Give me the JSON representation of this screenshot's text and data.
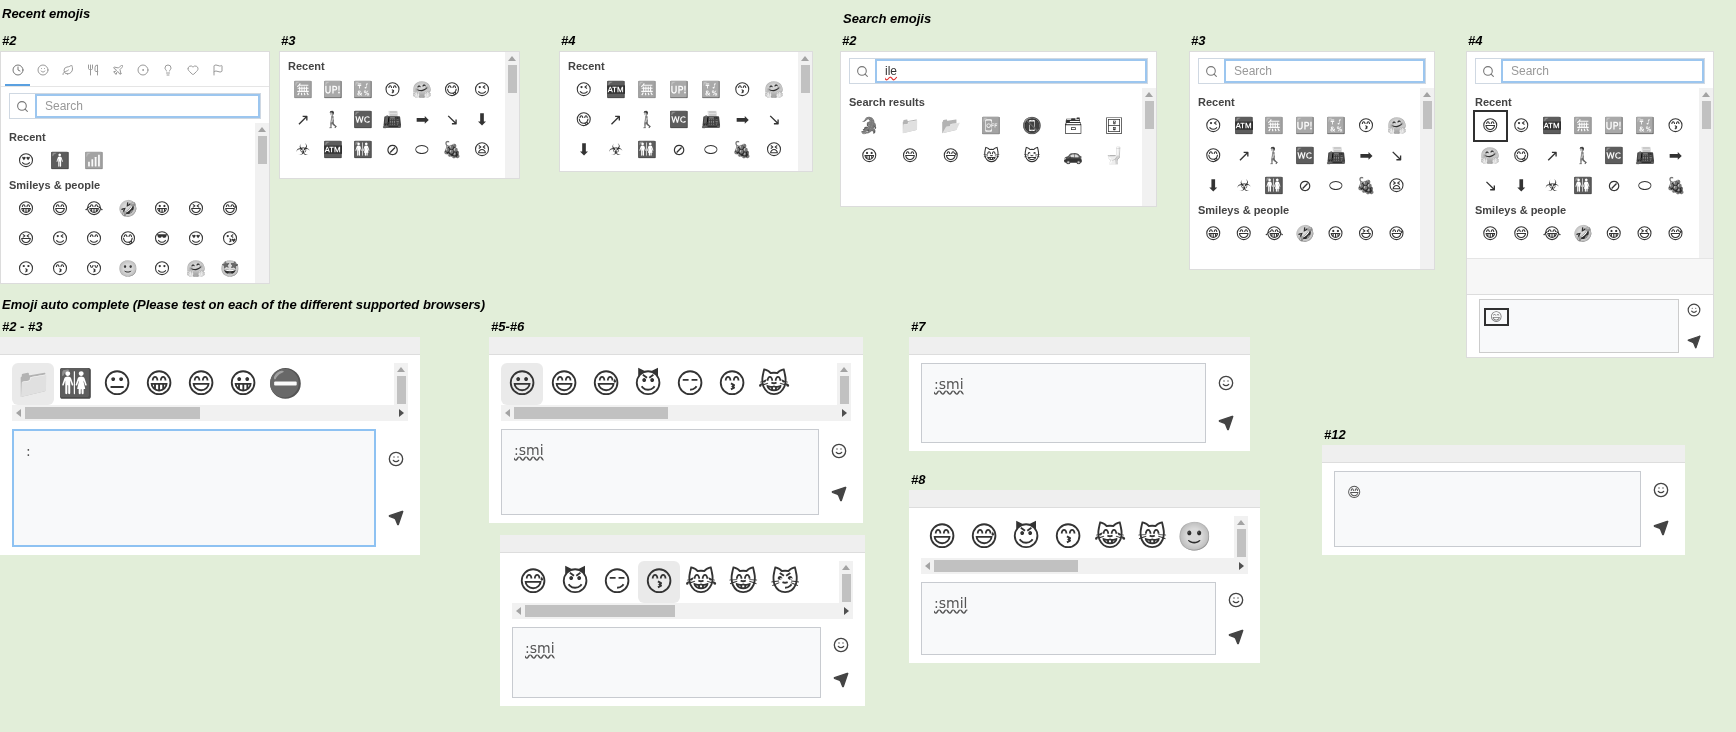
{
  "headings": [
    "Recent emojis",
    "Search emojis",
    "Emoji auto complete (Please test on each of the different supported browsers)"
  ],
  "panels": [
    {
      "kind": "picker",
      "label": "#2",
      "tabs": [
        {
          "selected": true
        },
        {
          "selected": false
        },
        {
          "selected": false
        },
        {
          "selected": false
        },
        {
          "selected": false
        },
        {
          "selected": false
        },
        {
          "selected": false
        },
        {
          "selected": false
        },
        {
          "selected": false
        }
      ],
      "search": {
        "placeholder": "Search"
      },
      "sections": [
        {
          "title": "Recent",
          "emojis": [
            "😍",
            "🚹",
            "📶"
          ]
        },
        {
          "title": "Smileys & people",
          "emojis": [
            "😁",
            "😄",
            "😂",
            "🤣",
            "😀",
            "😆",
            "😅",
            "😆",
            "😉",
            "😊",
            "😋",
            "😎",
            "😍",
            "😘",
            "😗",
            "😙",
            "😚",
            "🙂",
            "☺",
            "🤗",
            "🤩"
          ]
        }
      ]
    },
    {
      "kind": "picker",
      "label": "#3",
      "sections": [
        {
          "title": "Recent",
          "emojis": [
            "🈚",
            "🆙",
            "🔣",
            "😙",
            "🤗",
            "😋",
            "😉",
            "↗",
            "🚶",
            "🚾",
            "📠",
            "➡",
            "↘",
            "⬇",
            "☣",
            "🏧",
            "🚻",
            "⊘",
            "⬭",
            "🍇",
            "😫"
          ]
        }
      ]
    },
    {
      "kind": "picker",
      "label": "#4",
      "sections": [
        {
          "title": "Recent",
          "emojis": [
            "😉",
            "🏧",
            "🈚",
            "🆙",
            "🔣",
            "😙",
            "🤗",
            "😋",
            "↗",
            "🚶",
            "🚾",
            "📠",
            "➡",
            "↘",
            "⬇",
            "☣",
            "🚻",
            "⊘",
            "⬭",
            "🍇",
            "😫"
          ]
        }
      ]
    },
    {
      "kind": "picker",
      "label": "#2",
      "search": {
        "value": "ile"
      },
      "sections": [
        {
          "title": "Search results",
          "emojis": [
            "🐊",
            "📁",
            "📂",
            "📴",
            "📵",
            "🗃",
            "🗄",
            "😀",
            "😄",
            "😅",
            "😸",
            "😺",
            "🚗",
            "🚽"
          ]
        }
      ]
    },
    {
      "kind": "picker",
      "label": "#3",
      "search": {
        "placeholder": "Search"
      },
      "sections": [
        {
          "title": "Recent",
          "emojis": [
            "😉",
            "🏧",
            "🈚",
            "🆙",
            "🔣",
            "😙",
            "🤗",
            "😋",
            "↗",
            "🚶",
            "🚾",
            "📠",
            "➡",
            "↘",
            "⬇",
            "☣",
            "🚻",
            "⊘",
            "⬭",
            "🍇",
            "😫"
          ]
        },
        {
          "title": "Smileys & people",
          "emojis": [
            "😁",
            "😄",
            "😂",
            "🤣",
            "😀",
            "😆",
            "😅"
          ]
        }
      ]
    },
    {
      "kind": "picker",
      "label": "#4",
      "search": {
        "placeholder": "Search"
      },
      "sections": [
        {
          "title": "Recent",
          "emojis": [
            {
              "char": "😄",
              "marked": true
            },
            {
              "char": "😉",
              "marked": false
            },
            {
              "char": "🏧",
              "marked": false
            },
            {
              "char": "🈚",
              "marked": false
            },
            {
              "char": "🆙",
              "marked": false
            },
            {
              "char": "🔣",
              "marked": false
            },
            {
              "char": "😙",
              "marked": false
            },
            {
              "char": "🤗",
              "marked": false
            },
            {
              "char": "😋",
              "marked": false
            },
            {
              "char": "↗",
              "marked": false
            },
            {
              "char": "🚶",
              "marked": false
            },
            {
              "char": "🚾",
              "marked": false
            },
            {
              "char": "📠",
              "marked": false
            },
            {
              "char": "➡",
              "marked": false
            },
            {
              "char": "↘",
              "marked": false
            },
            {
              "char": "⬇",
              "marked": false
            },
            {
              "char": "☣",
              "marked": false
            },
            {
              "char": "🚻",
              "marked": false
            },
            {
              "char": "⊘",
              "marked": false
            },
            {
              "char": "⬭",
              "marked": false
            },
            {
              "char": "🍇",
              "marked": false
            }
          ]
        },
        {
          "title": "Smileys & people",
          "emojis": [
            "😁",
            "😄",
            "😂",
            "🤣",
            "😀",
            "😆",
            "😅"
          ]
        }
      ],
      "composer": {
        "text": "😄",
        "marked": true
      }
    },
    {
      "kind": "composer",
      "label": "#2 - #3",
      "suggestions": [
        {
          "char": "📁",
          "selected": true
        },
        {
          "char": "🚻",
          "selected": false
        },
        {
          "char": "😐",
          "selected": false
        },
        {
          "char": "😁",
          "selected": false
        },
        {
          "char": "😄",
          "selected": false
        },
        {
          "char": "😀",
          "selected": false
        },
        {
          "char": "⛔",
          "selected": false
        }
      ],
      "text": ":",
      "focused": true,
      "misspelled": false
    },
    {
      "kind": "composer",
      "label": "#5-#6",
      "suggestions": [
        {
          "char": "😃",
          "selected": true
        },
        {
          "char": "😄",
          "selected": false
        },
        {
          "char": "😅",
          "selected": false
        },
        {
          "char": "😈",
          "selected": false
        },
        {
          "char": "😏",
          "selected": false
        },
        {
          "char": "😙",
          "selected": false
        },
        {
          "char": "😹",
          "selected": false
        }
      ],
      "text": ":smi",
      "focused": false,
      "misspelled": true
    },
    {
      "kind": "composer",
      "suggestions": [
        {
          "char": "😅",
          "selected": false
        },
        {
          "char": "😈",
          "selected": false
        },
        {
          "char": "😏",
          "selected": false
        },
        {
          "char": "😙",
          "selected": true
        },
        {
          "char": "😹",
          "selected": false
        },
        {
          "char": "😸",
          "selected": false
        },
        {
          "char": "😼",
          "selected": false
        }
      ],
      "text": ":smi",
      "focused": false,
      "misspelled": true
    },
    {
      "kind": "composer",
      "label": "#7",
      "text": ":smi",
      "focused": false,
      "misspelled": true
    },
    {
      "kind": "composer",
      "label": "#8",
      "suggestions": [
        {
          "char": "😄",
          "selected": false
        },
        {
          "char": "😅",
          "selected": false
        },
        {
          "char": "😈",
          "selected": false
        },
        {
          "char": "😙",
          "selected": false
        },
        {
          "char": "😹",
          "selected": false
        },
        {
          "char": "😸",
          "selected": false
        },
        {
          "char": "🙂",
          "selected": false
        }
      ],
      "text": ":smil",
      "focused": false,
      "misspelled": true
    },
    {
      "kind": "composer",
      "label": "#12",
      "text": "😄",
      "focused": false,
      "misspelled": false
    }
  ]
}
